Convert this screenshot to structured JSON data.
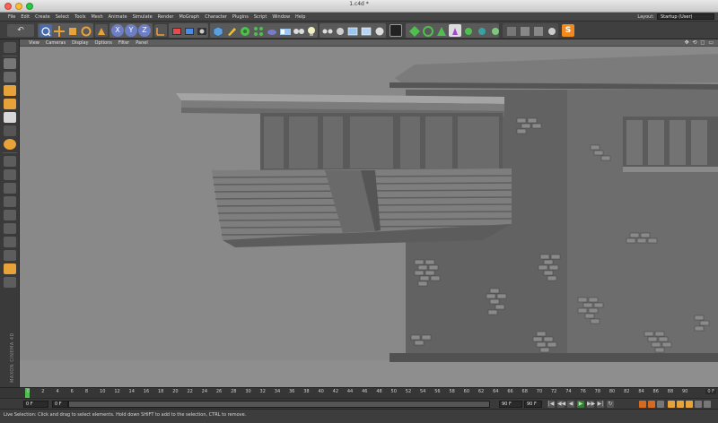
{
  "window": {
    "title": "1.c4d *"
  },
  "menubar": {
    "items": [
      "File",
      "Edit",
      "Create",
      "Select",
      "Tools",
      "Mesh",
      "Animate",
      "Simulate",
      "Render",
      "MoGraph",
      "Character",
      "Plugins",
      "Script",
      "Window",
      "Help"
    ],
    "layout_label": "Layout:",
    "layout_value": "Startup (User)"
  },
  "toolbar": {
    "icons": [
      "undo-icon",
      "live-selection-icon",
      "move-icon",
      "scale-icon",
      "rotate-icon",
      "recent-tools-icon",
      "x-axis-icon",
      "y-axis-icon",
      "z-axis-icon",
      "coordinate-system-icon",
      "render-view-icon",
      "render-picture-viewer-icon",
      "render-settings-icon",
      "cube-icon",
      "pen-icon",
      "subdivision-icon",
      "array-icon",
      "environment-icon",
      "camera-icon",
      "light-icon",
      "points-mode-icon",
      "edges-mode-icon",
      "polygons-mode-icon",
      "enable-axis-icon",
      "tweak-icon",
      "snap-icon",
      "workplane-icon",
      "python-icon"
    ],
    "axis_labels": [
      "X",
      "Y",
      "Z"
    ],
    "undo_glyph": "↶"
  },
  "viewport": {
    "menus": [
      "View",
      "Cameras",
      "Display",
      "Options",
      "Filter",
      "Panel"
    ],
    "controls": "✥ ⟲ ◻ ▭"
  },
  "palette": {
    "brand": "MAXON CINEMA 4D"
  },
  "timeline": {
    "frames": [
      "0",
      "2",
      "4",
      "6",
      "8",
      "10",
      "12",
      "14",
      "16",
      "18",
      "20",
      "22",
      "24",
      "26",
      "28",
      "30",
      "32",
      "34",
      "36",
      "38",
      "40",
      "42",
      "44",
      "46",
      "48",
      "50",
      "52",
      "54",
      "56",
      "58",
      "60",
      "62",
      "64",
      "66",
      "68",
      "70",
      "72",
      "74",
      "76",
      "78",
      "80",
      "82",
      "84",
      "86",
      "88",
      "90"
    ],
    "current": "0 F"
  },
  "transport": {
    "start_field": "0 F",
    "min_field": "0 F",
    "max_field": "90 F",
    "end_field": "90 F",
    "buttons": [
      "|◀",
      "◀◀",
      "◀",
      "▶",
      "▶▶",
      "▶|",
      "↻"
    ]
  },
  "statusbar": {
    "text": "Live Selection: Click and drag to select elements. Hold down SHIFT to add to the selection, CTRL to remove."
  },
  "colors": {
    "accent_orange": "#e8a23a",
    "accent_green": "#4fbf4f",
    "accent_blue": "#5aa0e0",
    "python_orange": "#f08a1e"
  }
}
